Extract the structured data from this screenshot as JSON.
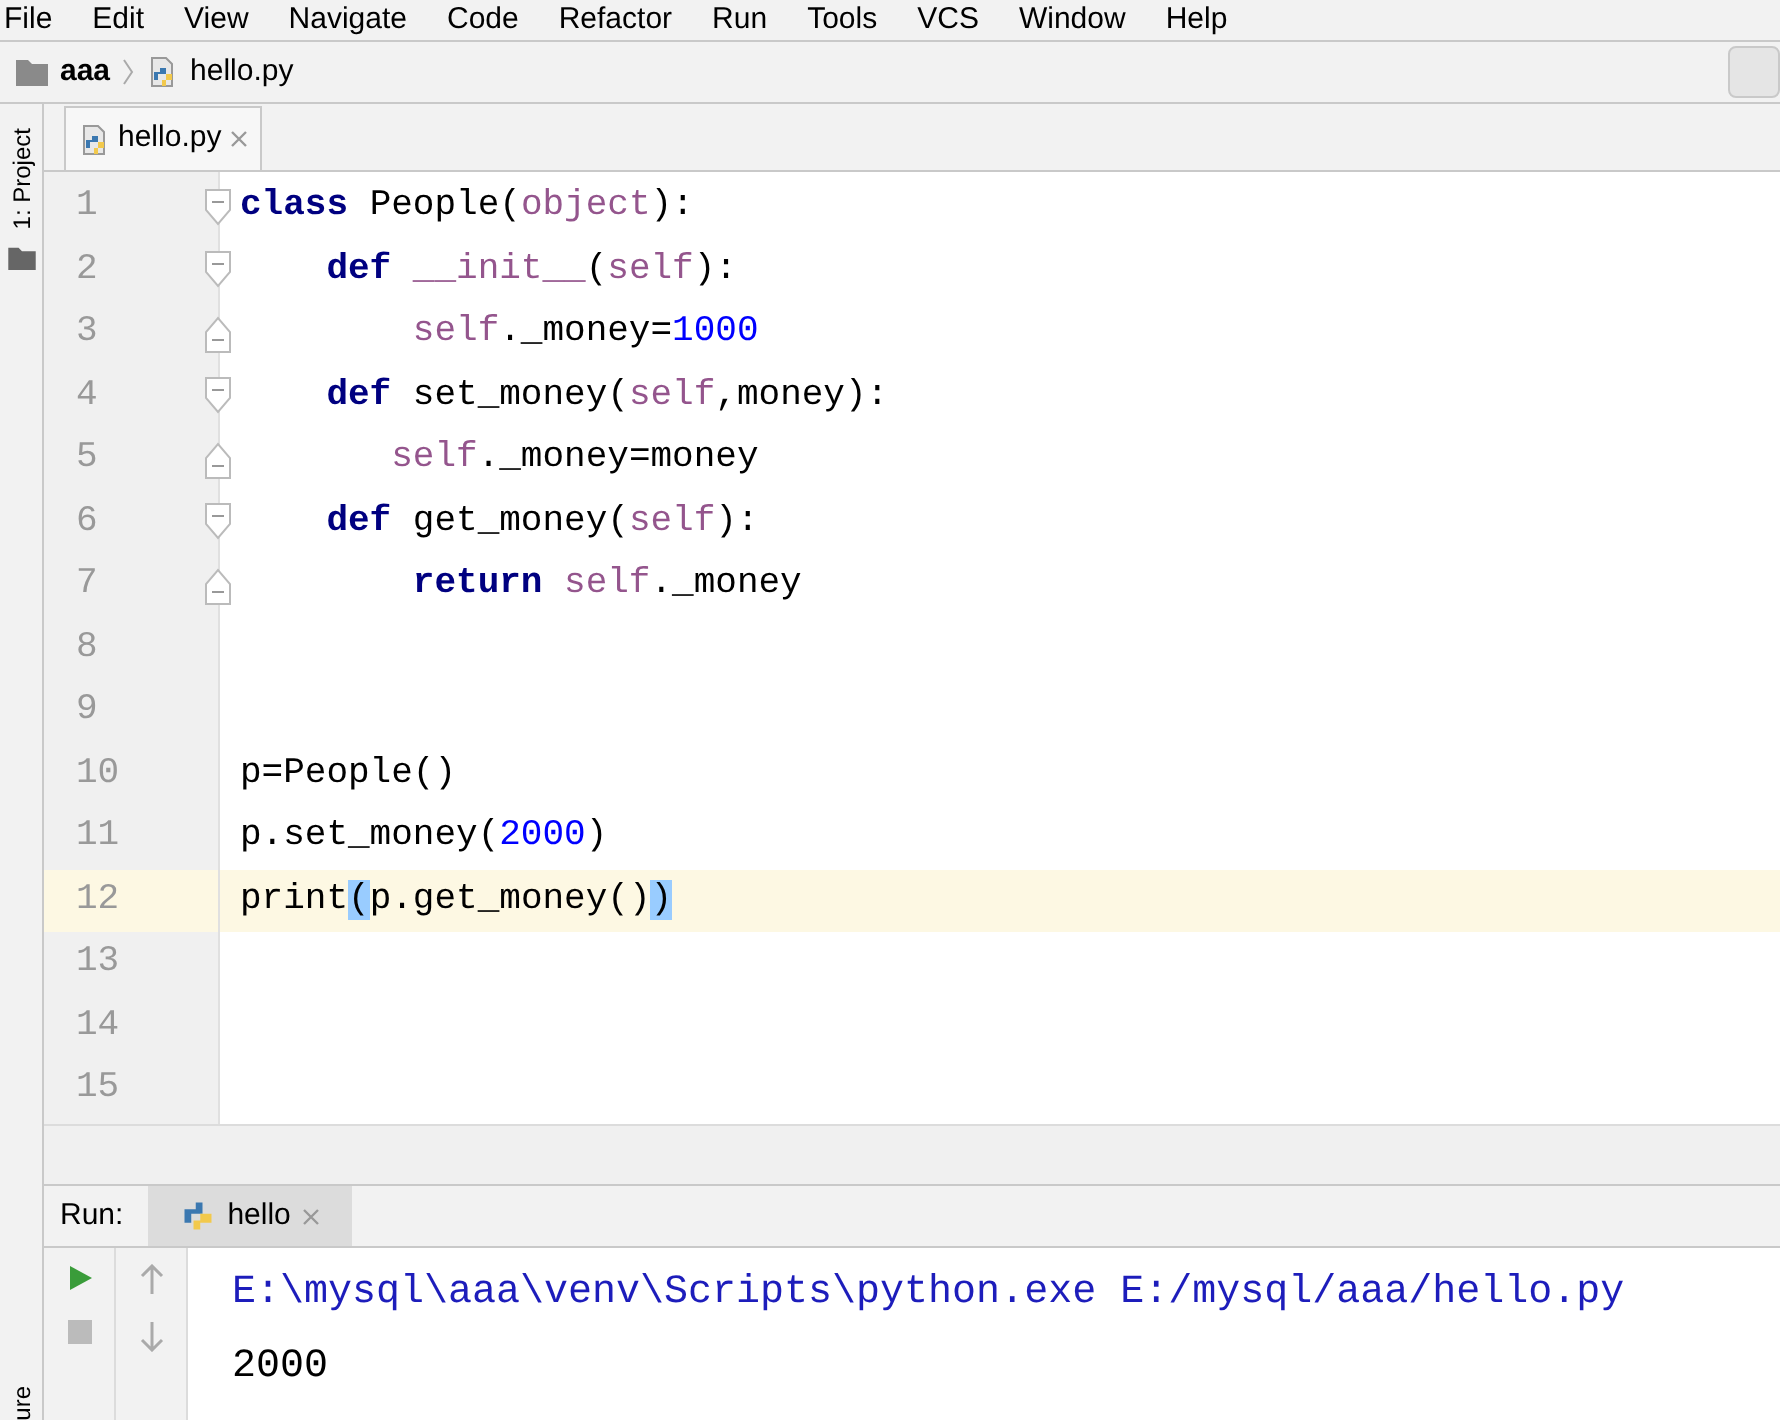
{
  "menu": [
    {
      "label": "File"
    },
    {
      "label": "Edit"
    },
    {
      "label": "View"
    },
    {
      "label": "Navigate"
    },
    {
      "label": "Code"
    },
    {
      "label": "Refactor"
    },
    {
      "label": "Run"
    },
    {
      "label": "Tools"
    },
    {
      "label": "VCS"
    },
    {
      "label": "Window"
    },
    {
      "label": "Help"
    }
  ],
  "breadcrumb": [
    {
      "label": "aaa",
      "kind": "folder"
    },
    {
      "label": "hello.py",
      "kind": "file"
    }
  ],
  "left_stripe": {
    "label": "1: Project"
  },
  "tabs": [
    {
      "label": "hello.py",
      "selected": true
    }
  ],
  "editor": {
    "lines": [
      {
        "number": "1",
        "fold_start": true,
        "fold_end": false,
        "current": false,
        "tokens": [
          {
            "kind": "keyword",
            "text": "class"
          },
          {
            "kind": "plain",
            "text": " People("
          },
          {
            "kind": "builtin",
            "text": "object"
          },
          {
            "kind": "plain",
            "text": "):"
          }
        ]
      },
      {
        "number": "2",
        "fold_start": true,
        "fold_end": false,
        "current": false,
        "tokens": [
          {
            "kind": "keyword",
            "text": "    def "
          },
          {
            "kind": "builtin",
            "text": "__init__"
          },
          {
            "kind": "plain",
            "text": "("
          },
          {
            "kind": "self",
            "text": "self"
          },
          {
            "kind": "plain",
            "text": "):"
          }
        ]
      },
      {
        "number": "3",
        "fold_start": false,
        "fold_end": true,
        "current": false,
        "tokens": [
          {
            "kind": "self",
            "text": "        self"
          },
          {
            "kind": "plain",
            "text": "._money="
          },
          {
            "kind": "number",
            "text": "1000"
          }
        ]
      },
      {
        "number": "4",
        "fold_start": true,
        "fold_end": false,
        "current": false,
        "tokens": [
          {
            "kind": "keyword",
            "text": "    def"
          },
          {
            "kind": "plain",
            "text": " set_money("
          },
          {
            "kind": "self",
            "text": "self"
          },
          {
            "kind": "plain",
            "text": ",money):"
          }
        ]
      },
      {
        "number": "5",
        "fold_start": false,
        "fold_end": true,
        "current": false,
        "tokens": [
          {
            "kind": "self",
            "text": "       self"
          },
          {
            "kind": "plain",
            "text": "._money=money"
          }
        ]
      },
      {
        "number": "6",
        "fold_start": true,
        "fold_end": false,
        "current": false,
        "tokens": [
          {
            "kind": "keyword",
            "text": "    def"
          },
          {
            "kind": "plain",
            "text": " get_money("
          },
          {
            "kind": "self",
            "text": "self"
          },
          {
            "kind": "plain",
            "text": "):"
          }
        ]
      },
      {
        "number": "7",
        "fold_start": false,
        "fold_end": true,
        "current": false,
        "tokens": [
          {
            "kind": "keyword",
            "text": "        return "
          },
          {
            "kind": "self",
            "text": "self"
          },
          {
            "kind": "plain",
            "text": "._money"
          }
        ]
      },
      {
        "number": "8",
        "fold_start": false,
        "fold_end": false,
        "current": false
      },
      {
        "number": "9",
        "fold_start": false,
        "fold_end": false,
        "current": false
      },
      {
        "number": "10",
        "fold_start": false,
        "fold_end": false,
        "current": false,
        "tokens": [
          {
            "kind": "plain",
            "text": "p=People()"
          }
        ]
      },
      {
        "number": "11",
        "fold_start": false,
        "fold_end": false,
        "current": false,
        "tokens": [
          {
            "kind": "plain",
            "text": "p.set_money("
          },
          {
            "kind": "number",
            "text": "2000"
          },
          {
            "kind": "plain",
            "text": ")"
          }
        ]
      },
      {
        "number": "12",
        "fold_start": false,
        "fold_end": false,
        "current": true,
        "tokens": [
          {
            "kind": "plain",
            "text": "print"
          },
          {
            "kind": "brace",
            "text": "("
          },
          {
            "kind": "plain",
            "text": "p.get_money()"
          },
          {
            "kind": "brace",
            "text": ")"
          }
        ]
      },
      {
        "number": "13",
        "fold_start": false,
        "fold_end": false,
        "current": false
      },
      {
        "number": "14",
        "fold_start": false,
        "fold_end": false,
        "current": false
      },
      {
        "number": "15",
        "fold_start": false,
        "fold_end": false,
        "current": false
      }
    ]
  },
  "run_panel": {
    "label": "Run:",
    "tabs": [
      {
        "label": "hello",
        "selected": true
      }
    ],
    "console": [
      {
        "kind": "command",
        "text": "E:\\mysql\\aaa\\venv\\Scripts\\python.exe E:/mysql/aaa/hello.py"
      },
      {
        "kind": "output",
        "text": "2000"
      }
    ]
  },
  "left_stripe_bottom": {
    "label": "ure"
  }
}
